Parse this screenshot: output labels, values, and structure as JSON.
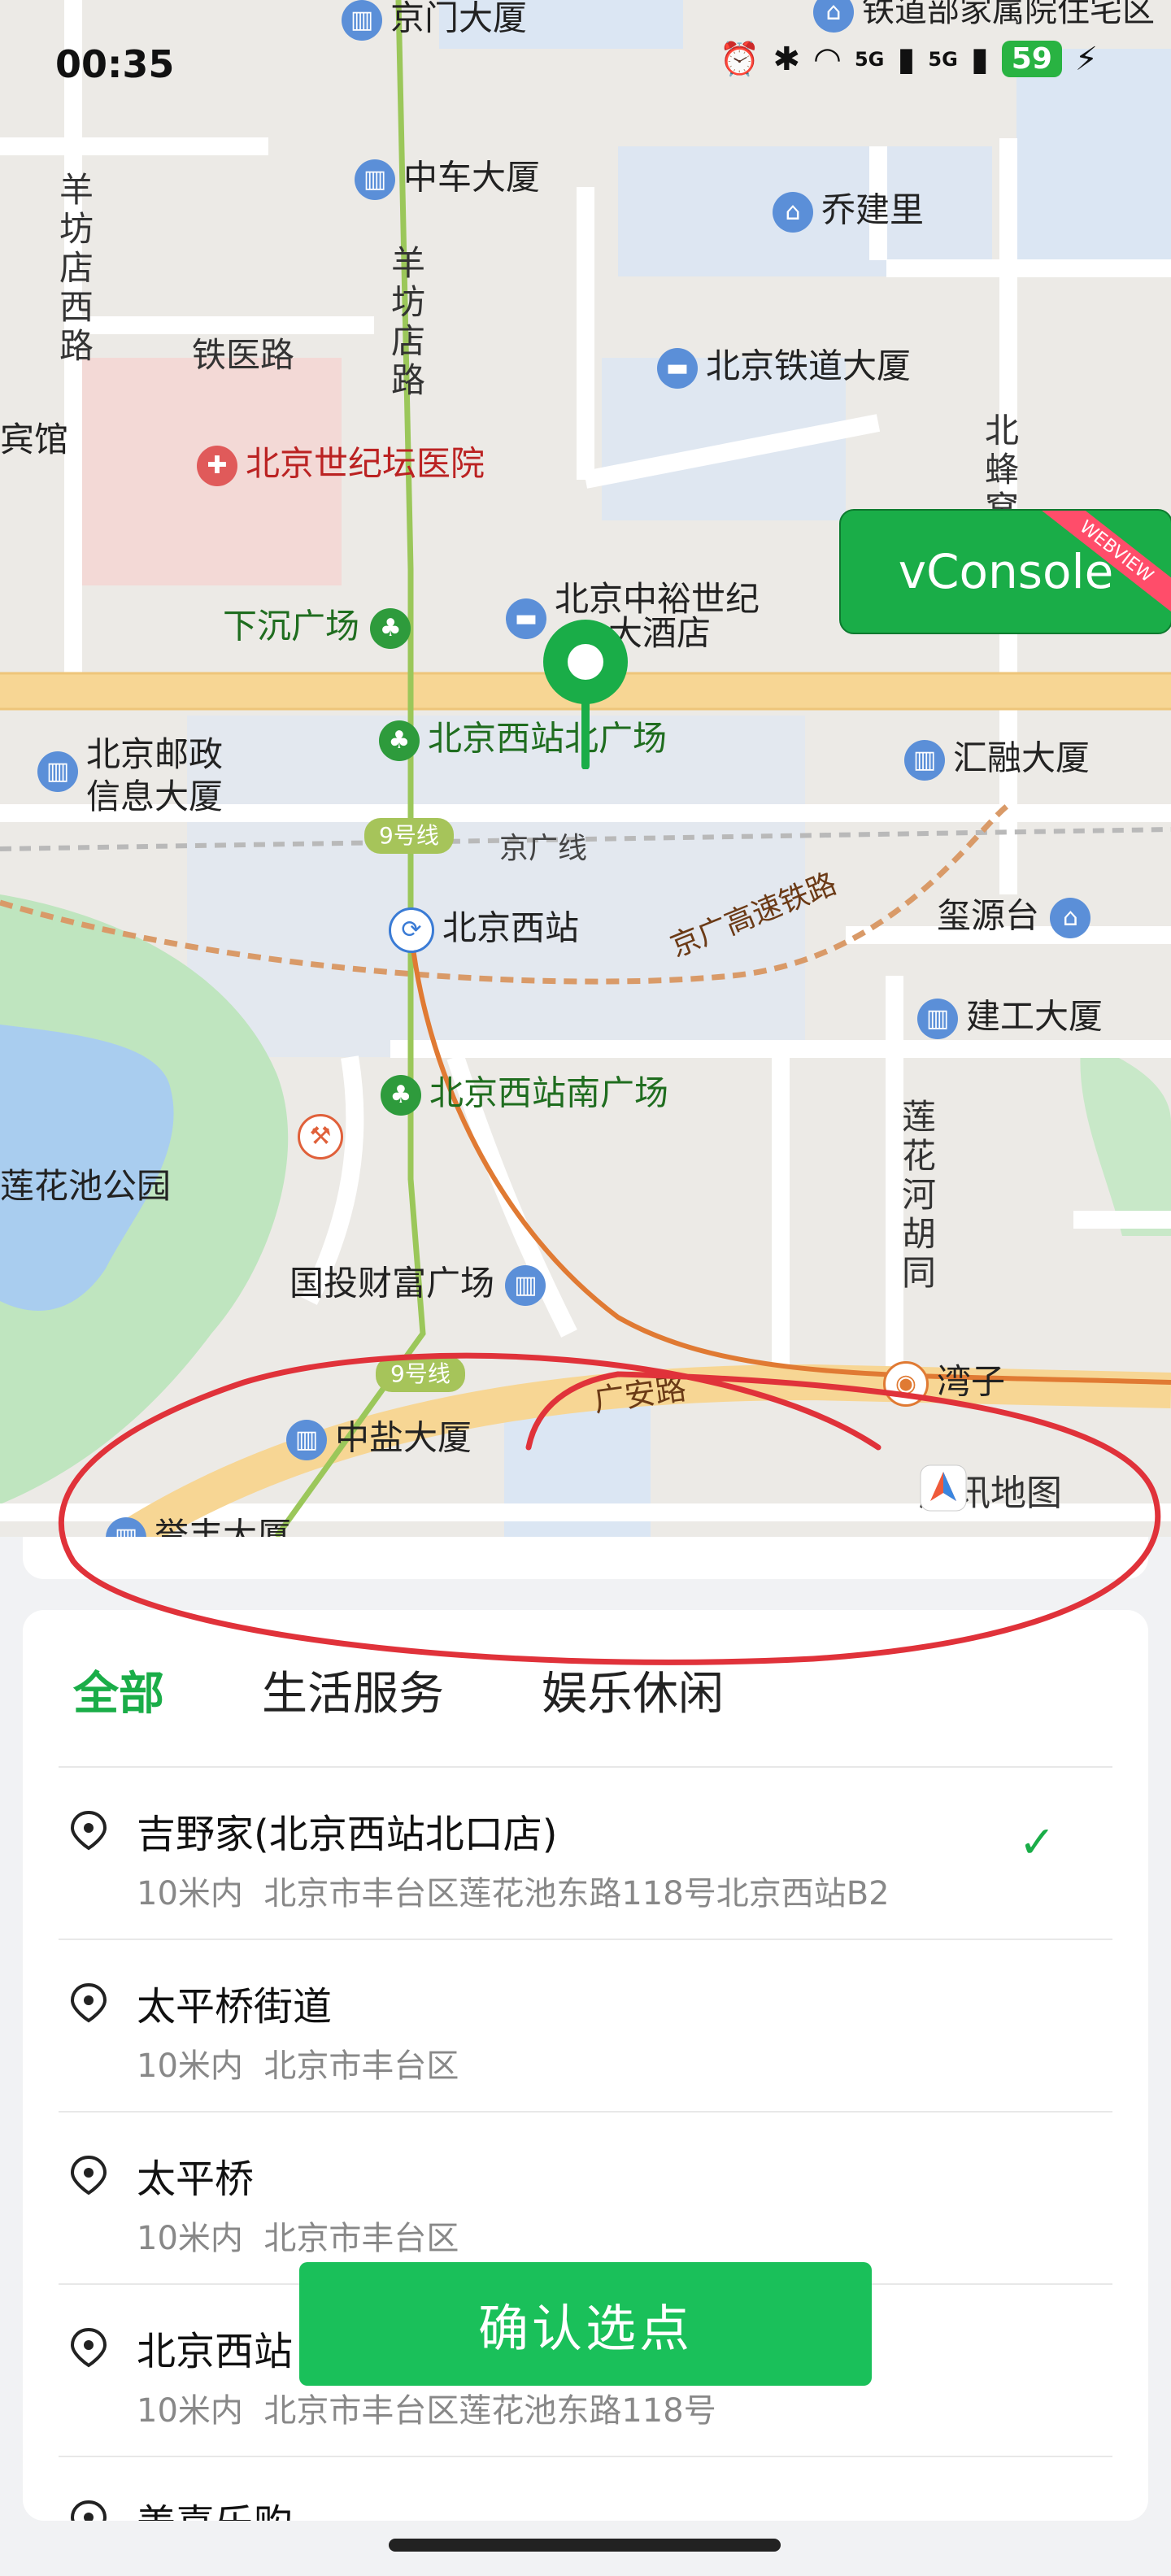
{
  "status_bar": {
    "time": "00:35",
    "signal_1": "5G",
    "signal_2": "5G",
    "battery": "59"
  },
  "map": {
    "labels": {
      "jingmen": "京门大厦",
      "zhongche": "中车大厦",
      "qiaojianli": "乔建里",
      "yangfang_xilu": "羊坊店西路",
      "tieyi": "铁医路",
      "yangfangdian": "羊坊店路",
      "tiedao": "北京铁道大厦",
      "hotel_left": "宾馆",
      "shijitan": "北京世纪坛医院",
      "beifeng": "北蜂窝",
      "xiachen": "下沉广场",
      "zhongyu_1": "北京中裕世纪",
      "zhongyu_2": "大酒店",
      "youzheng_1": "北京邮政",
      "youzheng_2": "信息大厦",
      "beiguangchang": "北京西站北广场",
      "huirong": "汇融大厦",
      "line9": "9号线",
      "jingguang": "京广线",
      "xizhan": "北京西站",
      "gaosu": "京广高速铁路",
      "xiyuan": "玺源台",
      "jiangong": "建工大厦",
      "nanguangchang": "北京西站南广场",
      "lianhuachi": "莲花池公园",
      "lianhuahe": "莲花河胡同",
      "guotou": "国投财富广场",
      "line9b": "9号线",
      "wanzi": "湾子",
      "guanganlu": "广安路",
      "zhongyan": "中盐大厦",
      "top_right": "铁道部家属院住宅区",
      "bottom_partial": "誉丰大厦",
      "tencent_map": "腾讯地图"
    },
    "vconsole": "vConsole",
    "vconsole_tag": "WEBVIEW"
  },
  "sheet": {
    "tabs": [
      "全部",
      "生活服务",
      "娱乐休闲"
    ],
    "items": [
      {
        "name": "吉野家(北京西站北口店)",
        "distance": "10米内",
        "address": "北京市丰台区莲花池东路118号北京西站B2",
        "selected": "✓"
      },
      {
        "name": "太平桥街道",
        "distance": "10米内",
        "address": "北京市丰台区"
      },
      {
        "name": "太平桥",
        "distance": "10米内",
        "address": "北京市丰台区"
      },
      {
        "name": "北京西站",
        "distance": "10米内",
        "address": "北京市丰台区莲花池东路118号"
      },
      {
        "name": "姜喜乐购",
        "distance": "",
        "address": ""
      }
    ],
    "confirm_label": "确认选点"
  },
  "colors": {
    "accent": "#1aad48",
    "annotation": "#e0323a"
  }
}
